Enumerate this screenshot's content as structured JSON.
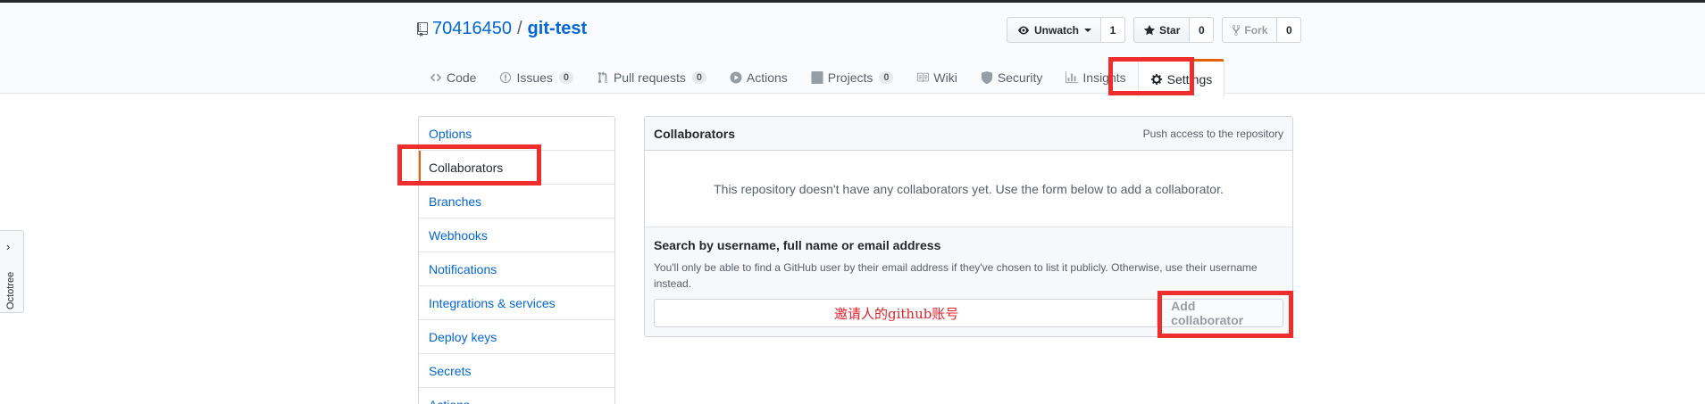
{
  "repo": {
    "owner": "70416450",
    "separator": "/",
    "name": "git-test"
  },
  "actions": {
    "watch": {
      "label": "Unwatch",
      "count": "1"
    },
    "star": {
      "label": "Star",
      "count": "0"
    },
    "fork": {
      "label": "Fork",
      "count": "0"
    }
  },
  "nav": {
    "code": "Code",
    "issues": {
      "label": "Issues",
      "count": "0"
    },
    "pulls": {
      "label": "Pull requests",
      "count": "0"
    },
    "actions": "Actions",
    "projects": {
      "label": "Projects",
      "count": "0"
    },
    "wiki": "Wiki",
    "security": "Security",
    "insights": "Insights",
    "settings": "Settings"
  },
  "sidebar": {
    "items": [
      {
        "label": "Options"
      },
      {
        "label": "Collaborators"
      },
      {
        "label": "Branches"
      },
      {
        "label": "Webhooks"
      },
      {
        "label": "Notifications"
      },
      {
        "label": "Integrations & services"
      },
      {
        "label": "Deploy keys"
      },
      {
        "label": "Secrets"
      },
      {
        "label": "Actions"
      }
    ],
    "selected": "Collaborators"
  },
  "collaborators": {
    "title": "Collaborators",
    "note": "Push access to the repository",
    "blank": "This repository doesn't have any collaborators yet. Use the form below to add a collaborator.",
    "search_label": "Search by username, full name or email address",
    "search_note": "You'll only be able to find a GitHub user by their email address if they've chosen to list it publicly. Otherwise, use their username instead.",
    "search_value": "",
    "add_button": "Add collaborator"
  },
  "annotation": "邀请人的github账号",
  "octotree": {
    "label": "Octotree"
  },
  "colors": {
    "highlight": "#ee2d2d",
    "link": "#0366d6",
    "accent": "#e36209"
  }
}
